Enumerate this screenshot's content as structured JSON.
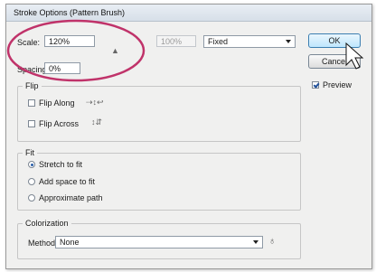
{
  "window": {
    "title": "Stroke Options (Pattern Brush)"
  },
  "scale": {
    "label": "Scale:",
    "value": "120%",
    "max_value": "100%",
    "mode": "Fixed"
  },
  "spacing": {
    "label": "Spacing:",
    "value": "0%"
  },
  "flip": {
    "legend": "Flip",
    "along_label": "Flip Along",
    "across_label": "Flip Across",
    "along_checked": false,
    "across_checked": false
  },
  "fit": {
    "legend": "Fit",
    "options": [
      "Stretch to fit",
      "Add space to fit",
      "Approximate path"
    ],
    "selected": 0
  },
  "colorization": {
    "legend": "Colorization",
    "method_label": "Method:",
    "method_value": "None"
  },
  "buttons": {
    "ok": "OK",
    "cancel": "Cancel"
  },
  "preview": {
    "label": "Preview",
    "checked": true
  },
  "colors": {
    "annotation": "#c0336a",
    "accent": "#3c7fb1"
  },
  "icons": {
    "flip_along": "flip-along-icon",
    "flip_across": "flip-across-icon",
    "tip": "lightbulb-icon",
    "cursor": "mouse-pointer-icon"
  }
}
